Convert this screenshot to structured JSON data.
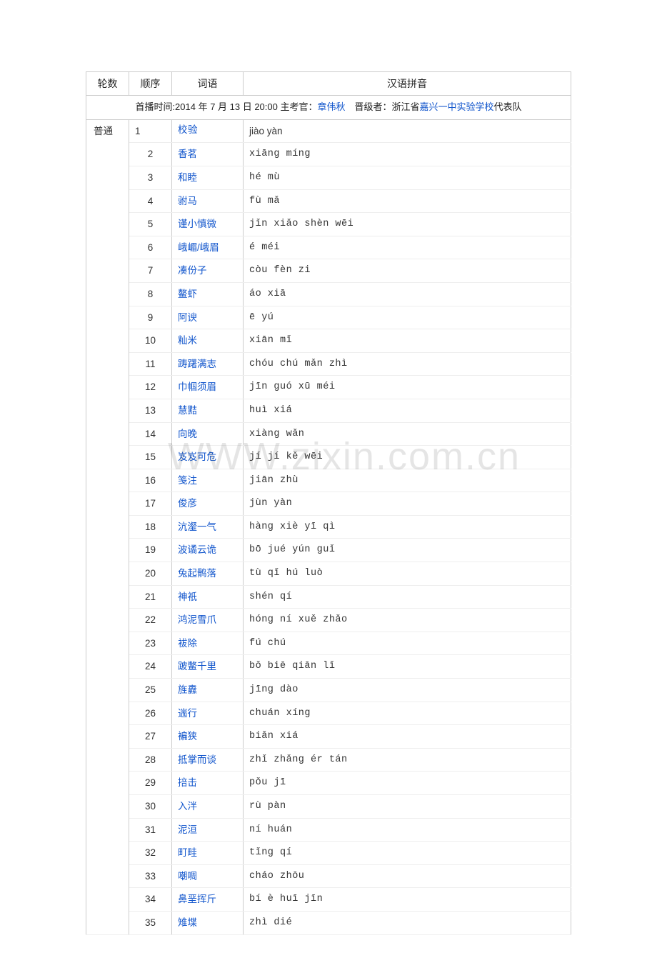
{
  "headers": {
    "round": "轮数",
    "order": "顺序",
    "word": "词语",
    "pinyin": "汉语拼音"
  },
  "info": {
    "prefix": "首播时间:2014 年 7 月 13 日 20:00 主考官：",
    "examiner": "章伟秋",
    "mid": "　晋级者：浙江省",
    "school": "嘉兴一中实验学校",
    "suffix": "代表队"
  },
  "round_label": "普通",
  "watermark": "WWW.zixin.com.cn",
  "rows": [
    {
      "order": "1",
      "word": "校验",
      "pinyin": "jiào yàn"
    },
    {
      "order": "2",
      "word": "香茗",
      "pinyin": "xiāng míng"
    },
    {
      "order": "3",
      "word": "和睦",
      "pinyin": "hé mù"
    },
    {
      "order": "4",
      "word": "驸马",
      "pinyin": "fù mǎ"
    },
    {
      "order": "5",
      "word": "谨小慎微",
      "pinyin": "jǐn xiǎo shèn wēi"
    },
    {
      "order": "6",
      "word": "峨嵋/峨眉",
      "pinyin": "é méi"
    },
    {
      "order": "7",
      "word": "凑份子",
      "pinyin": "còu fèn zi"
    },
    {
      "order": "8",
      "word": "鳌虾",
      "pinyin": "áo xiā"
    },
    {
      "order": "9",
      "word": "阿谀",
      "pinyin": "ē yú"
    },
    {
      "order": "10",
      "word": "籼米",
      "pinyin": "xiān mǐ"
    },
    {
      "order": "11",
      "word": "踌躇满志",
      "pinyin": "chóu chú mǎn zhì"
    },
    {
      "order": "12",
      "word": "巾帼须眉",
      "pinyin": "jīn guó xū méi"
    },
    {
      "order": "13",
      "word": "慧黠",
      "pinyin": "huì xiá"
    },
    {
      "order": "14",
      "word": "向晚",
      "pinyin": "xiàng wǎn"
    },
    {
      "order": "15",
      "word": "岌岌可危",
      "pinyin": "jí jí kě wēi"
    },
    {
      "order": "16",
      "word": "笺注",
      "pinyin": "jiān zhù"
    },
    {
      "order": "17",
      "word": "俊彦",
      "pinyin": "jùn yàn"
    },
    {
      "order": "18",
      "word": "沆瀣一气",
      "pinyin": "hàng xiè yī qì"
    },
    {
      "order": "19",
      "word": "波谲云诡",
      "pinyin": "bō jué yún guǐ"
    },
    {
      "order": "20",
      "word": "兔起鹘落",
      "pinyin": "tù qǐ hú luò"
    },
    {
      "order": "21",
      "word": "神祇",
      "pinyin": "shén qí"
    },
    {
      "order": "22",
      "word": "鸿泥雪爪",
      "pinyin": "hóng ní xuě zhǎo"
    },
    {
      "order": "23",
      "word": "袚除",
      "pinyin": "fú chú"
    },
    {
      "order": "24",
      "word": "跛鳖千里",
      "pinyin": "bǒ biē qiān lǐ"
    },
    {
      "order": "25",
      "word": "旌纛",
      "pinyin": "jīng dào"
    },
    {
      "order": "26",
      "word": "遄行",
      "pinyin": "chuán xíng"
    },
    {
      "order": "27",
      "word": "褊狭",
      "pinyin": "biǎn xiá"
    },
    {
      "order": "28",
      "word": "抵掌而谈",
      "pinyin": "zhǐ zhǎng ér tán"
    },
    {
      "order": "29",
      "word": "掊击",
      "pinyin": "pǒu jī"
    },
    {
      "order": "30",
      "word": "入泮",
      "pinyin": "rù pàn"
    },
    {
      "order": "31",
      "word": "泥洹",
      "pinyin": "ní huán"
    },
    {
      "order": "32",
      "word": "町畦",
      "pinyin": "tǐng qí"
    },
    {
      "order": "33",
      "word": "嘲啁",
      "pinyin": "cháo zhōu"
    },
    {
      "order": "34",
      "word": "鼻垩挥斤",
      "pinyin": "bí è huī jīn"
    },
    {
      "order": "35",
      "word": "雉堞",
      "pinyin": "zhì dié"
    }
  ]
}
